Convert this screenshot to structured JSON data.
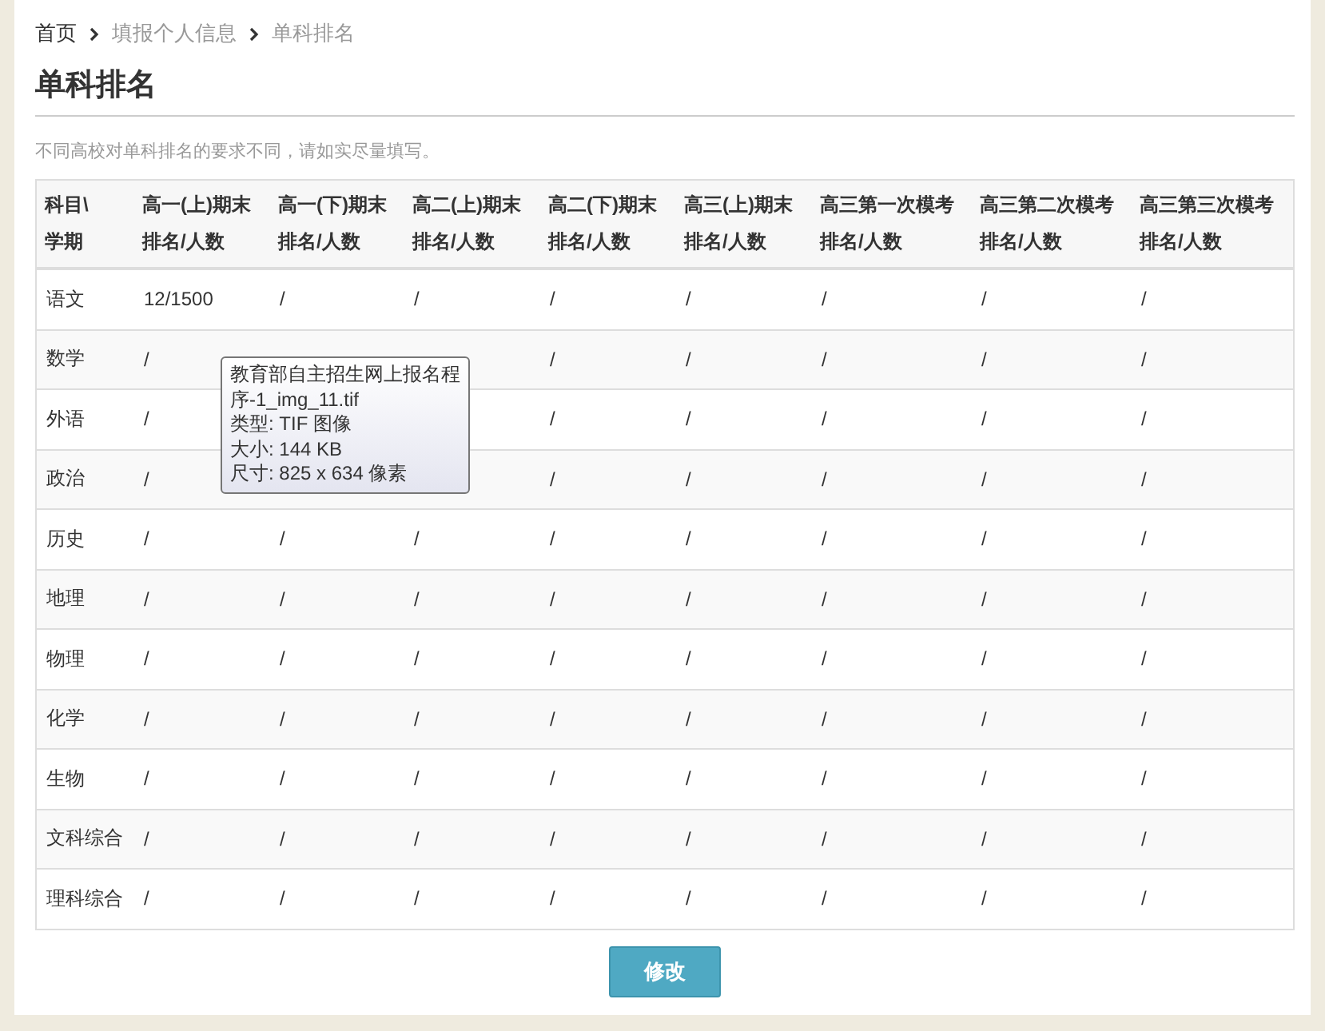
{
  "breadcrumb": [
    {
      "label": "首页",
      "current": false
    },
    {
      "label": "填报个人信息",
      "current": true
    },
    {
      "label": "单科排名",
      "current": true
    }
  ],
  "title": "单科排名",
  "note": "不同高校对单科排名的要求不同，请如实尽量填写。",
  "table": {
    "header_rows": [
      [
        "科目\\",
        "高一(上)期末",
        "高一(下)期末",
        "高二(上)期末",
        "高二(下)期末",
        "高三(上)期末",
        "高三第一次模考",
        "高三第二次模考",
        "高三第三次模考"
      ],
      [
        "学期",
        "排名/人数",
        "排名/人数",
        "排名/人数",
        "排名/人数",
        "排名/人数",
        "排名/人数",
        "排名/人数",
        "排名/人数"
      ]
    ],
    "rows": [
      {
        "subject": "语文",
        "cells": [
          "12/1500",
          "/",
          "/",
          "/",
          "/",
          "/",
          "/",
          "/"
        ]
      },
      {
        "subject": "数学",
        "cells": [
          "/",
          null,
          null,
          "/",
          "/",
          "/",
          "/",
          "/"
        ]
      },
      {
        "subject": "外语",
        "cells": [
          "/",
          null,
          null,
          "/",
          "/",
          "/",
          "/",
          "/"
        ]
      },
      {
        "subject": "政治",
        "cells": [
          "/",
          null,
          null,
          "/",
          "/",
          "/",
          "/",
          "/"
        ]
      },
      {
        "subject": "历史",
        "cells": [
          "/",
          "/",
          "/",
          "/",
          "/",
          "/",
          "/",
          "/"
        ]
      },
      {
        "subject": "地理",
        "cells": [
          "/",
          "/",
          "/",
          "/",
          "/",
          "/",
          "/",
          "/"
        ]
      },
      {
        "subject": "物理",
        "cells": [
          "/",
          "/",
          "/",
          "/",
          "/",
          "/",
          "/",
          "/"
        ]
      },
      {
        "subject": "化学",
        "cells": [
          "/",
          "/",
          "/",
          "/",
          "/",
          "/",
          "/",
          "/"
        ]
      },
      {
        "subject": "生物",
        "cells": [
          "/",
          "/",
          "/",
          "/",
          "/",
          "/",
          "/",
          "/"
        ]
      },
      {
        "subject": "文科综合",
        "cells": [
          "/",
          "/",
          "/",
          "/",
          "/",
          "/",
          "/",
          "/"
        ]
      },
      {
        "subject": "理科综合",
        "cells": [
          "/",
          "/",
          "/",
          "/",
          "/",
          "/",
          "/",
          "/"
        ]
      }
    ]
  },
  "tooltip": [
    "教育部自主招生网上报名程",
    "序-1_img_11.tif",
    "类型: TIF 图像",
    "大小: 144 KB",
    "尺寸: 825 x 634 像素"
  ],
  "button": "修改"
}
